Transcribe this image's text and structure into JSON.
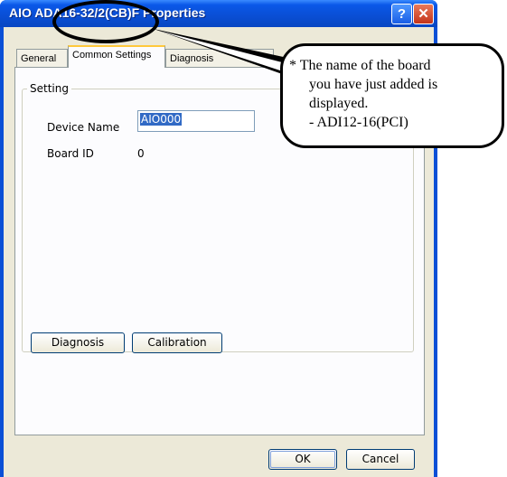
{
  "window": {
    "title": "AIO ADA16-32/2(CB)F Properties",
    "help_glyph": "?",
    "close_glyph": "✕"
  },
  "tabs": [
    {
      "label": "General"
    },
    {
      "label": "Common Settings",
      "selected": true
    },
    {
      "label": "Diagnosis"
    }
  ],
  "setting_group": {
    "label": "Setting",
    "device_name_label": "Device Name",
    "device_name_value": "AIO000",
    "board_id_label": "Board ID",
    "board_id_value": "0"
  },
  "buttons": {
    "diagnosis": "Diagnosis",
    "calibration": "Calibration",
    "ok": "OK",
    "cancel": "Cancel"
  },
  "callout": {
    "lines": [
      "* The name of the board",
      "you have just added is",
      "displayed.",
      "- ADI12-16(PCI)"
    ]
  },
  "colors": {
    "titlebar": "#0a4fd6",
    "dialog_bg": "#ece9d8",
    "selection": "#316ac5"
  }
}
